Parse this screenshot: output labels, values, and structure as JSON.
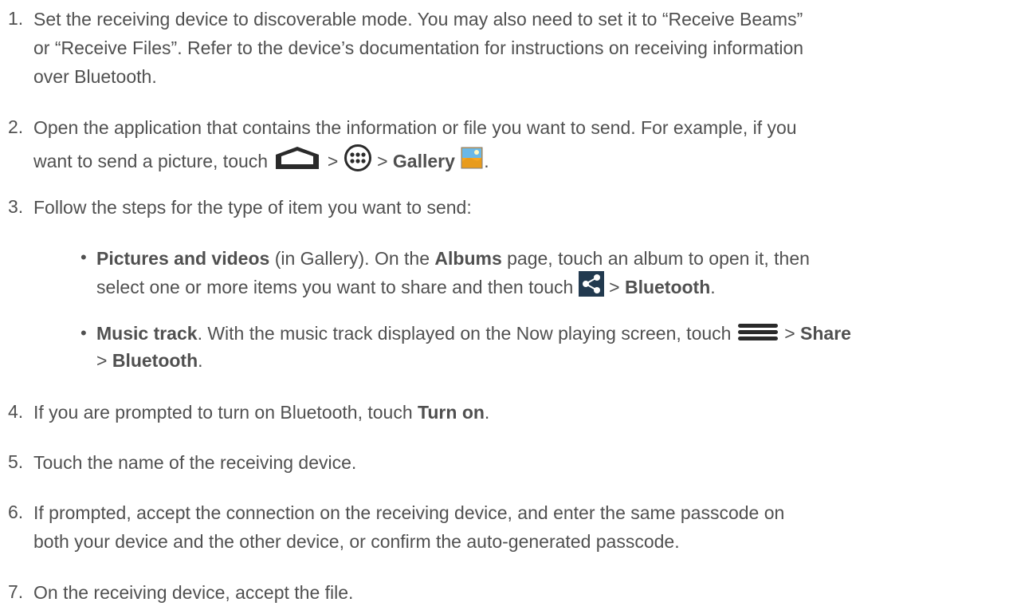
{
  "steps": [
    {
      "num": "1.",
      "lines": [
        "Set the receiving device to discoverable mode. You may also need to set it to “Receive Beams”",
        "or “Receive Files”. Refer to the device’s documentation for instructions on receiving information",
        "over Bluetooth."
      ]
    },
    {
      "num": "2.",
      "line1": "Open the application that contains the information or file you want to send. For example, if you",
      "line2_a": "want to send a picture, touch",
      "sep1": ">",
      "sep2": ">",
      "gallery": "Gallery",
      "end": "."
    },
    {
      "num": "3.",
      "text": "Follow the steps for the type of item you want to send:"
    },
    {
      "num": "4.",
      "text_a": "If you are prompted to turn on Bluetooth, touch",
      "bold": "Turn on",
      "end": "."
    },
    {
      "num": "5.",
      "text": "Touch the name of the receiving device."
    },
    {
      "num": "6.",
      "lines": [
        "If prompted, accept the connection on the receiving device, and enter the same passcode on",
        "both your device and the other device, or confirm the auto-generated passcode."
      ]
    },
    {
      "num": "7.",
      "text": "On the receiving device, accept the file."
    }
  ],
  "bullets": [
    {
      "bold1": "Pictures and videos",
      "t1": " (in Gallery). On the ",
      "bold2": "Albums",
      "t2": " page, touch an album to open it, then",
      "t3": "select one or more items you want to share and then touch",
      "t4": " > ",
      "bold3": "Bluetooth",
      "t5": "."
    },
    {
      "bold1": "Music track",
      "t1": ". With the music track displayed on the Now playing screen, touch",
      "t2": " > ",
      "bold2": "Share",
      "t3": "> ",
      "bold3": "Bluetooth",
      "t4": "."
    }
  ],
  "icons": [
    "home-icon",
    "apps-icon",
    "gallery-icon",
    "share-icon",
    "menu-icon"
  ]
}
